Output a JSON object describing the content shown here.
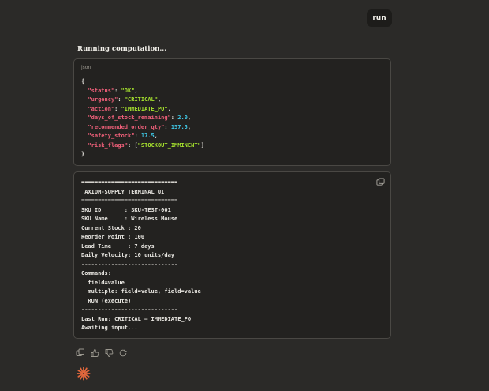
{
  "toolbar": {
    "run_label": "run"
  },
  "status_text": "Running computation...",
  "json_block": {
    "language": "json",
    "open": "{",
    "close": "}",
    "fields": [
      {
        "key": "\"status\"",
        "value": "\"OK\"",
        "type": "string",
        "sep": ","
      },
      {
        "key": "\"urgency\"",
        "value": "\"CRITICAL\"",
        "type": "string",
        "sep": ","
      },
      {
        "key": "\"action\"",
        "value": "\"IMMEDIATE_PO\"",
        "type": "string",
        "sep": ","
      },
      {
        "key": "\"days_of_stock_remaining\"",
        "value": "2.0",
        "type": "number",
        "sep": ","
      },
      {
        "key": "\"recommended_order_qty\"",
        "value": "157.5",
        "type": "number",
        "sep": ","
      },
      {
        "key": "\"safety_stock\"",
        "value": "17.5",
        "type": "number",
        "sep": ","
      },
      {
        "key": "\"risk_flags\"",
        "value": "[\"STOCKOUT_IMMINENT\"]",
        "type": "array",
        "sep": ""
      }
    ]
  },
  "terminal": {
    "lines": [
      "=============================",
      " AXIOM-SUPPLY TERMINAL UI",
      "=============================",
      "SKU ID       : SKU-TEST-001",
      "SKU Name     : Wireless Mouse",
      "Current Stock : 20",
      "Reorder Point : 100",
      "Lead Time     : 7 days",
      "Daily Velocity: 10 units/day",
      "-----------------------------",
      "Commands:",
      "  field=value",
      "  multiple: field=value, field=value",
      "  RUN (execute)",
      "-----------------------------",
      "Last Run: CRITICAL — IMMEDIATE_PO",
      "Awaiting input..."
    ]
  },
  "colors": {
    "key": "#f0607a",
    "string": "#a6e22e",
    "number": "#3fc8e6",
    "logo": "#e0673c"
  },
  "icons": [
    "copy-icon",
    "thumbs-up-icon",
    "thumbs-down-icon",
    "retry-icon",
    "starburst-logo-icon"
  ]
}
